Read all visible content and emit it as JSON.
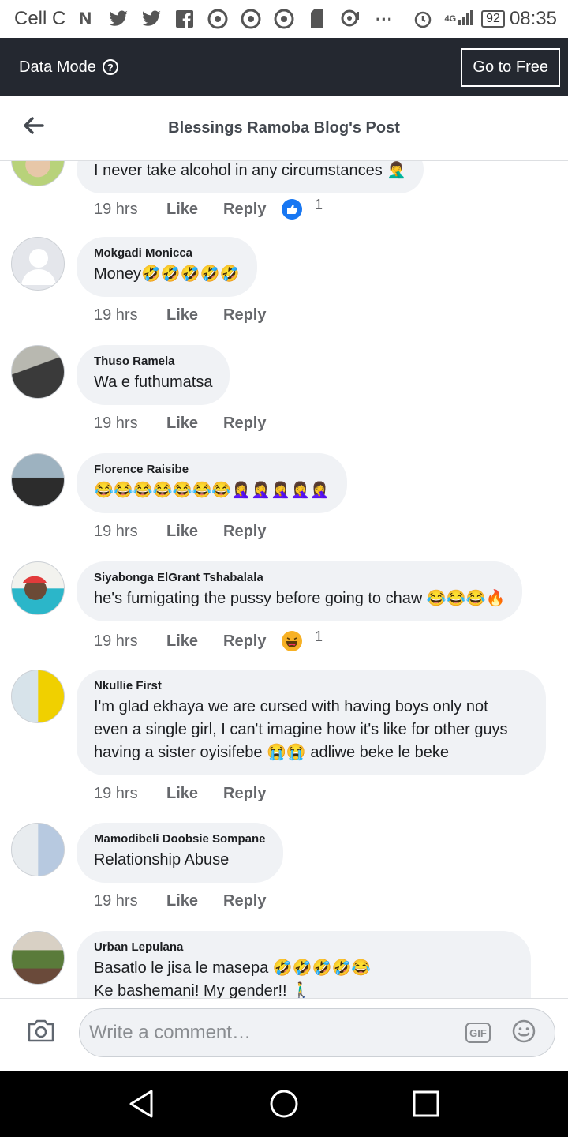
{
  "status_bar": {
    "carrier": "Cell C",
    "icons": [
      "n-icon",
      "twitter-icon",
      "twitter-icon",
      "facebook-icon",
      "chrome-icon",
      "chrome-icon",
      "chrome-icon",
      "sd-card-icon",
      "hotspot-icon",
      "more-icon"
    ],
    "alarm_icon": "alarm-icon",
    "network": "4G",
    "battery": "92",
    "time": "08:35"
  },
  "data_bar": {
    "label": "Data Mode",
    "help_icon": "?",
    "button": "Go to Free"
  },
  "header": {
    "title": "Blessings Ramoba Blog's Post"
  },
  "comments": [
    {
      "name": "",
      "text": "I never take alcohol in any circumstances 🤦‍♂️",
      "time": "19 hrs",
      "like": "Like",
      "reply": "Reply",
      "reaction": "like",
      "reaction_count": "1"
    },
    {
      "name": "Mokgadi Monicca",
      "text": "Money🤣🤣🤣🤣🤣",
      "time": "19 hrs",
      "like": "Like",
      "reply": "Reply"
    },
    {
      "name": "Thuso Ramela",
      "text": "Wa e futhumatsa",
      "time": "19 hrs",
      "like": "Like",
      "reply": "Reply"
    },
    {
      "name": "Florence Raisibe",
      "text": "😂😂😂😂😂😂😂🤦‍♀️🤦‍♀️🤦‍♀️🤦‍♀️🤦‍♀️",
      "time": "19 hrs",
      "like": "Like",
      "reply": "Reply"
    },
    {
      "name": "Siyabonga ElGrant Tshabalala",
      "text": "he's fumigating the pussy before going to chaw 😂😂😂🔥",
      "time": "19 hrs",
      "like": "Like",
      "reply": "Reply",
      "reaction": "haha",
      "reaction_count": "1"
    },
    {
      "name": "Nkullie First",
      "text": "I'm glad ekhaya we are cursed with having boys only not\neven a single girl, I can't imagine how it's like for other guys\nhaving a sister oyisifebe 😭😭 adliwe beke le beke",
      "time": "19 hrs",
      "like": "Like",
      "reply": "Reply"
    },
    {
      "name": "Mamodibeli Doobsie Sompane",
      "text": "Relationship Abuse",
      "time": "19 hrs",
      "like": "Like",
      "reply": "Reply"
    },
    {
      "name": "Urban Lepulana",
      "text": "Basatlo le jisa le masepa 🤣🤣🤣🤣😂\nKe bashemani! My gender!! 🚶‍♂️",
      "time": "",
      "like": "",
      "reply": ""
    }
  ],
  "composer": {
    "placeholder": "Write a comment…",
    "gif_label": "GIF"
  },
  "colors": {
    "bubble": "#f0f2f5",
    "data_bar": "#242830",
    "like_blue": "#1877f2",
    "haha_yellow": "#f7b125"
  }
}
